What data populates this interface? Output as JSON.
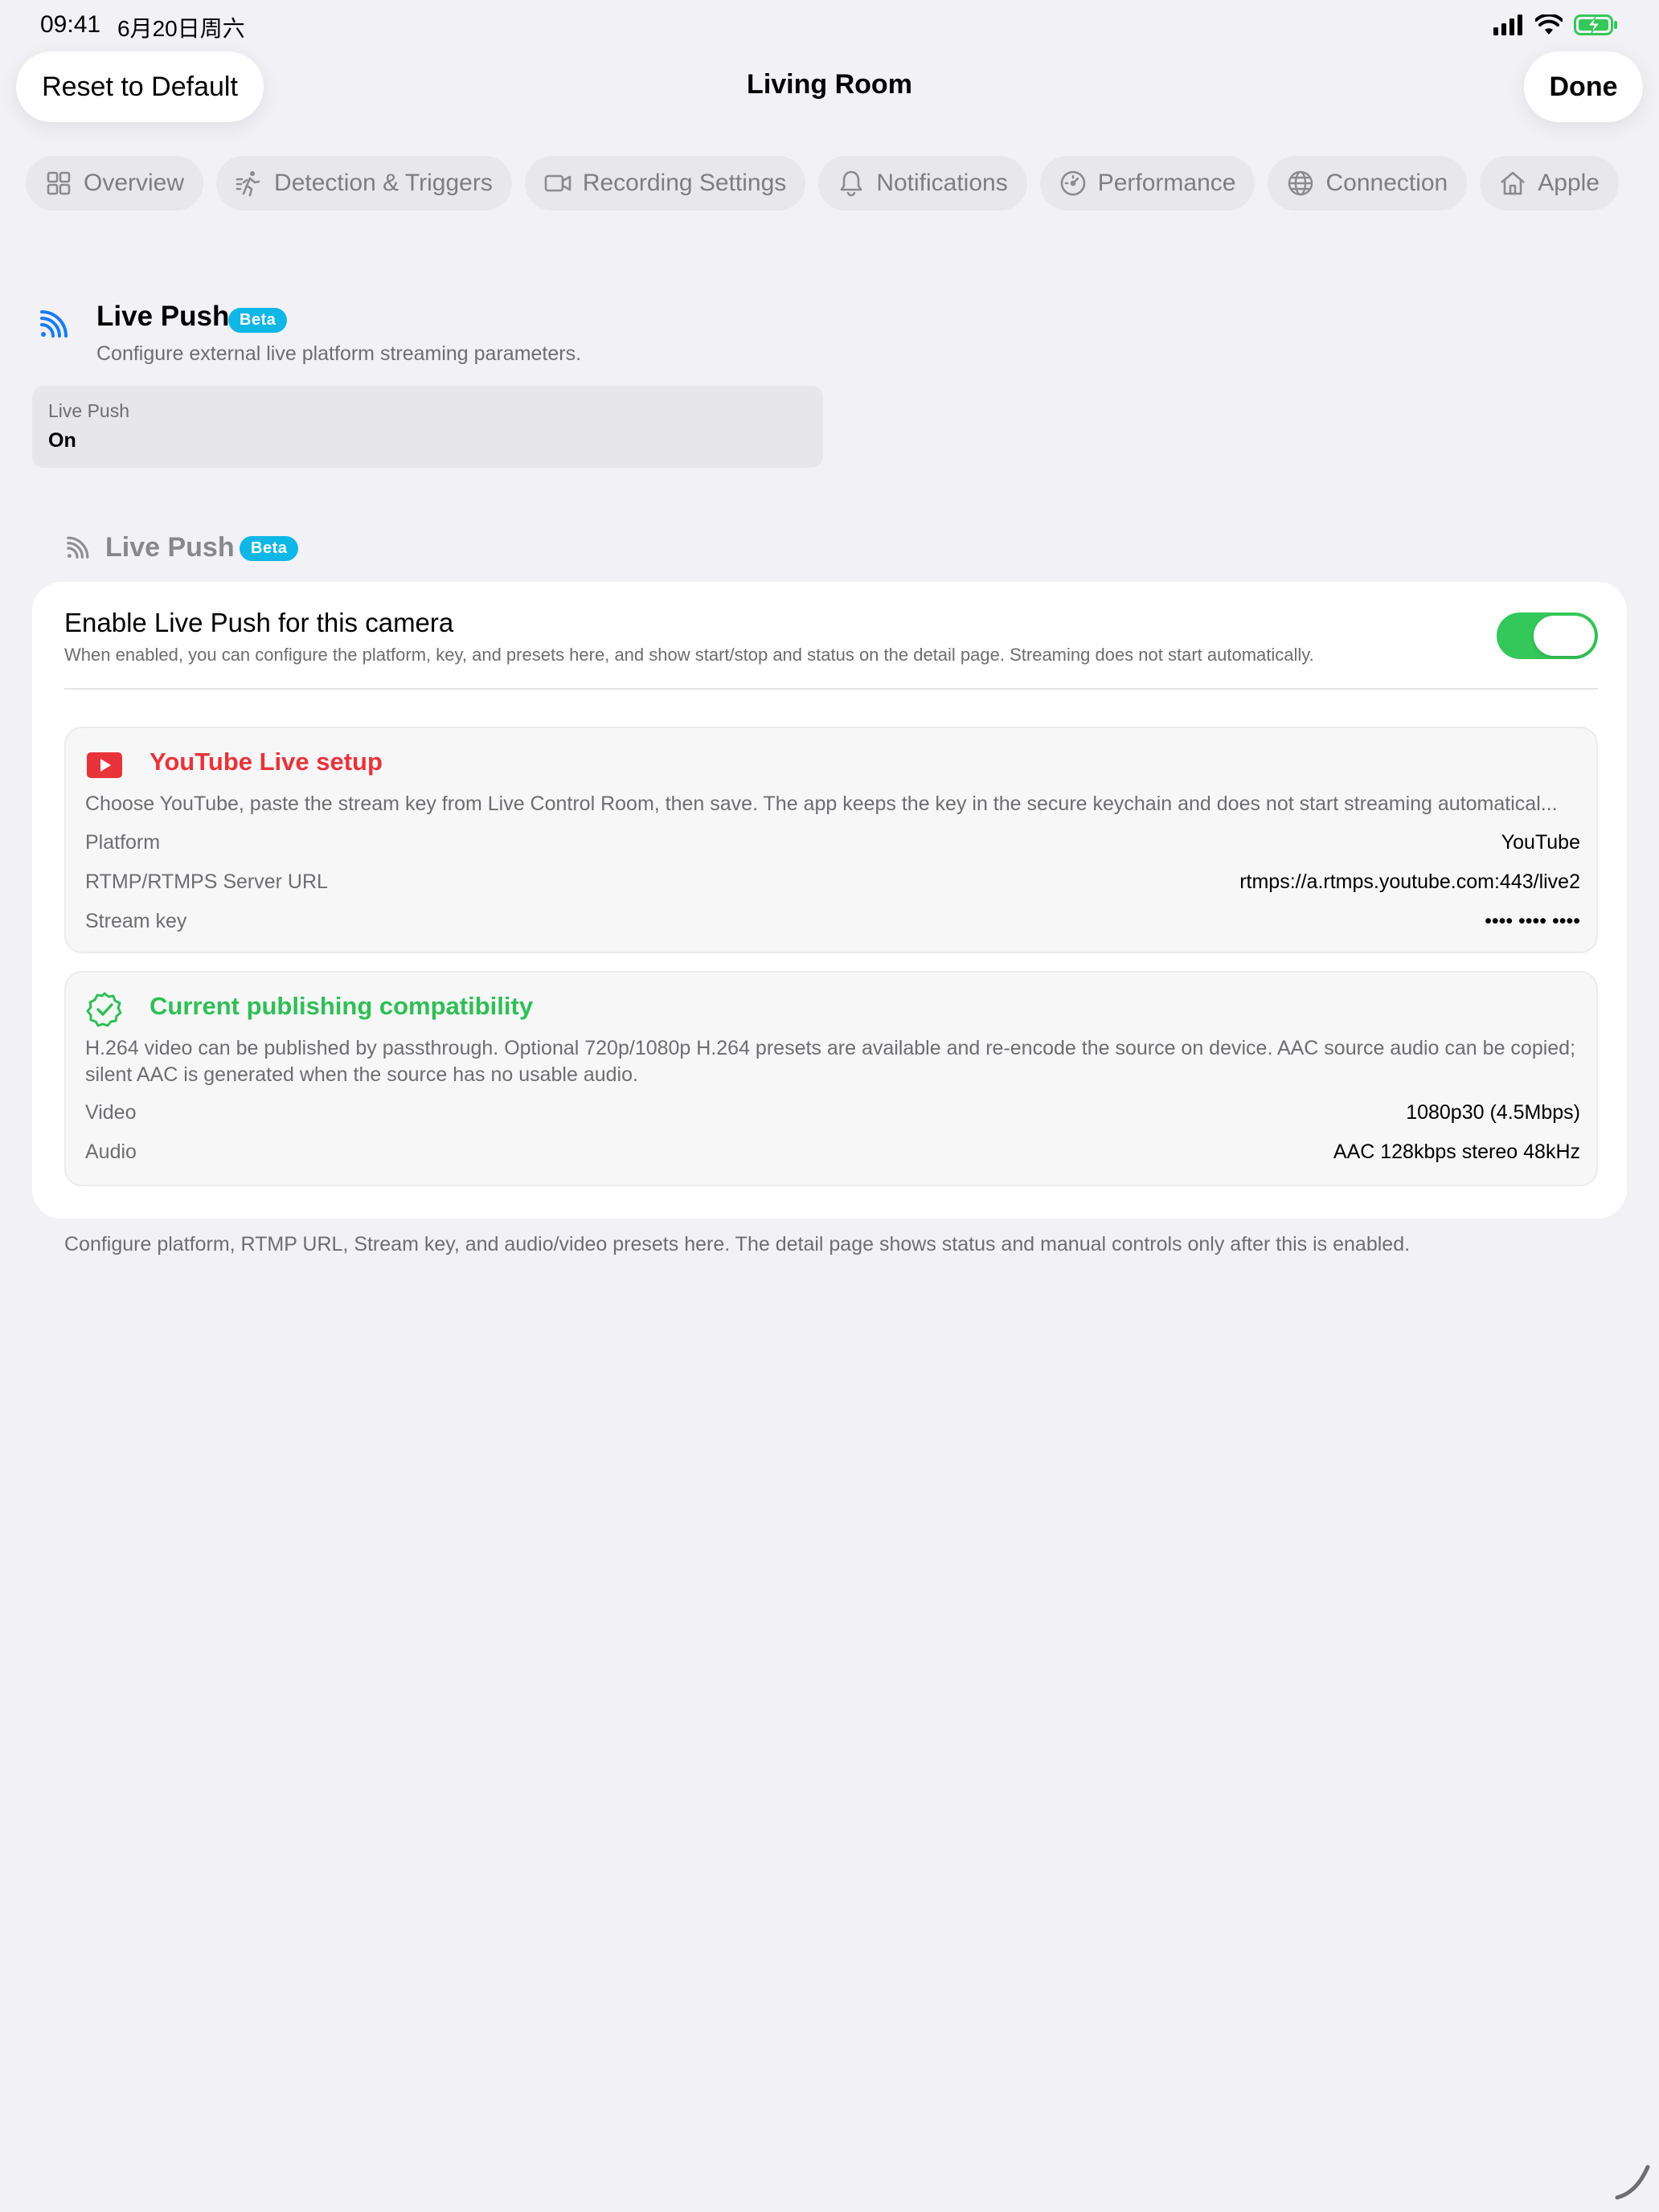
{
  "status_bar": {
    "time": "09:41",
    "date": "6月20日周六"
  },
  "nav": {
    "reset_label": "Reset to Default",
    "title": "Living Room",
    "done_label": "Done"
  },
  "tabs": [
    {
      "label": "Overview",
      "icon": "grid-icon"
    },
    {
      "label": "Detection & Triggers",
      "icon": "running-person-icon"
    },
    {
      "label": "Recording Settings",
      "icon": "video-camera-icon"
    },
    {
      "label": "Notifications",
      "icon": "bell-icon"
    },
    {
      "label": "Performance",
      "icon": "gauge-icon"
    },
    {
      "label": "Connection",
      "icon": "globe-icon"
    },
    {
      "label": "Apple",
      "icon": "home-icon"
    }
  ],
  "live_push_section": {
    "title": "Live Push",
    "badge": "Beta",
    "description": "Configure external live platform streaming parameters.",
    "summary_label": "Live Push",
    "summary_value": "On"
  },
  "group": {
    "title": "Live Push",
    "badge": "Beta"
  },
  "enable": {
    "title": "Enable Live Push for this camera",
    "description": "When enabled, you can configure the platform, key, and presets here, and show start/stop and status on the detail page. Streaming does not start automatically.",
    "enabled": true
  },
  "youtube_setup": {
    "title": "YouTube Live setup",
    "description": "Choose YouTube, paste the stream key from Live Control Room, then save. The app keeps the key in the secure keychain and does not start streaming automatical...",
    "rows": [
      {
        "label": "Platform",
        "value": "YouTube"
      },
      {
        "label": "RTMP/RTMPS Server URL",
        "value": "rtmps://a.rtmps.youtube.com:443/live2"
      },
      {
        "label": "Stream key",
        "value": "•••• •••• ••••"
      }
    ]
  },
  "compatibility": {
    "title": "Current publishing compatibility",
    "description": "H.264 video can be published by passthrough. Optional 720p/1080p H.264 presets are available and re-encode the source on device. AAC source audio can be copied; silent AAC is generated when the source has no usable audio.",
    "rows": [
      {
        "label": "Video",
        "value": "1080p30 (4.5Mbps)"
      },
      {
        "label": "Audio",
        "value": "AAC 128kbps stereo 48kHz"
      }
    ]
  },
  "footer_note": "Configure platform, RTMP URL, Stream key, and audio/video presets here. The detail page shows status and manual controls only after this is enabled.",
  "colors": {
    "accent_blue": "#1a7cf2",
    "beta_badge": "#0fb7e6",
    "toggle_on": "#34c759",
    "youtube_red": "#e8333a",
    "compat_green": "#2fbf55"
  }
}
